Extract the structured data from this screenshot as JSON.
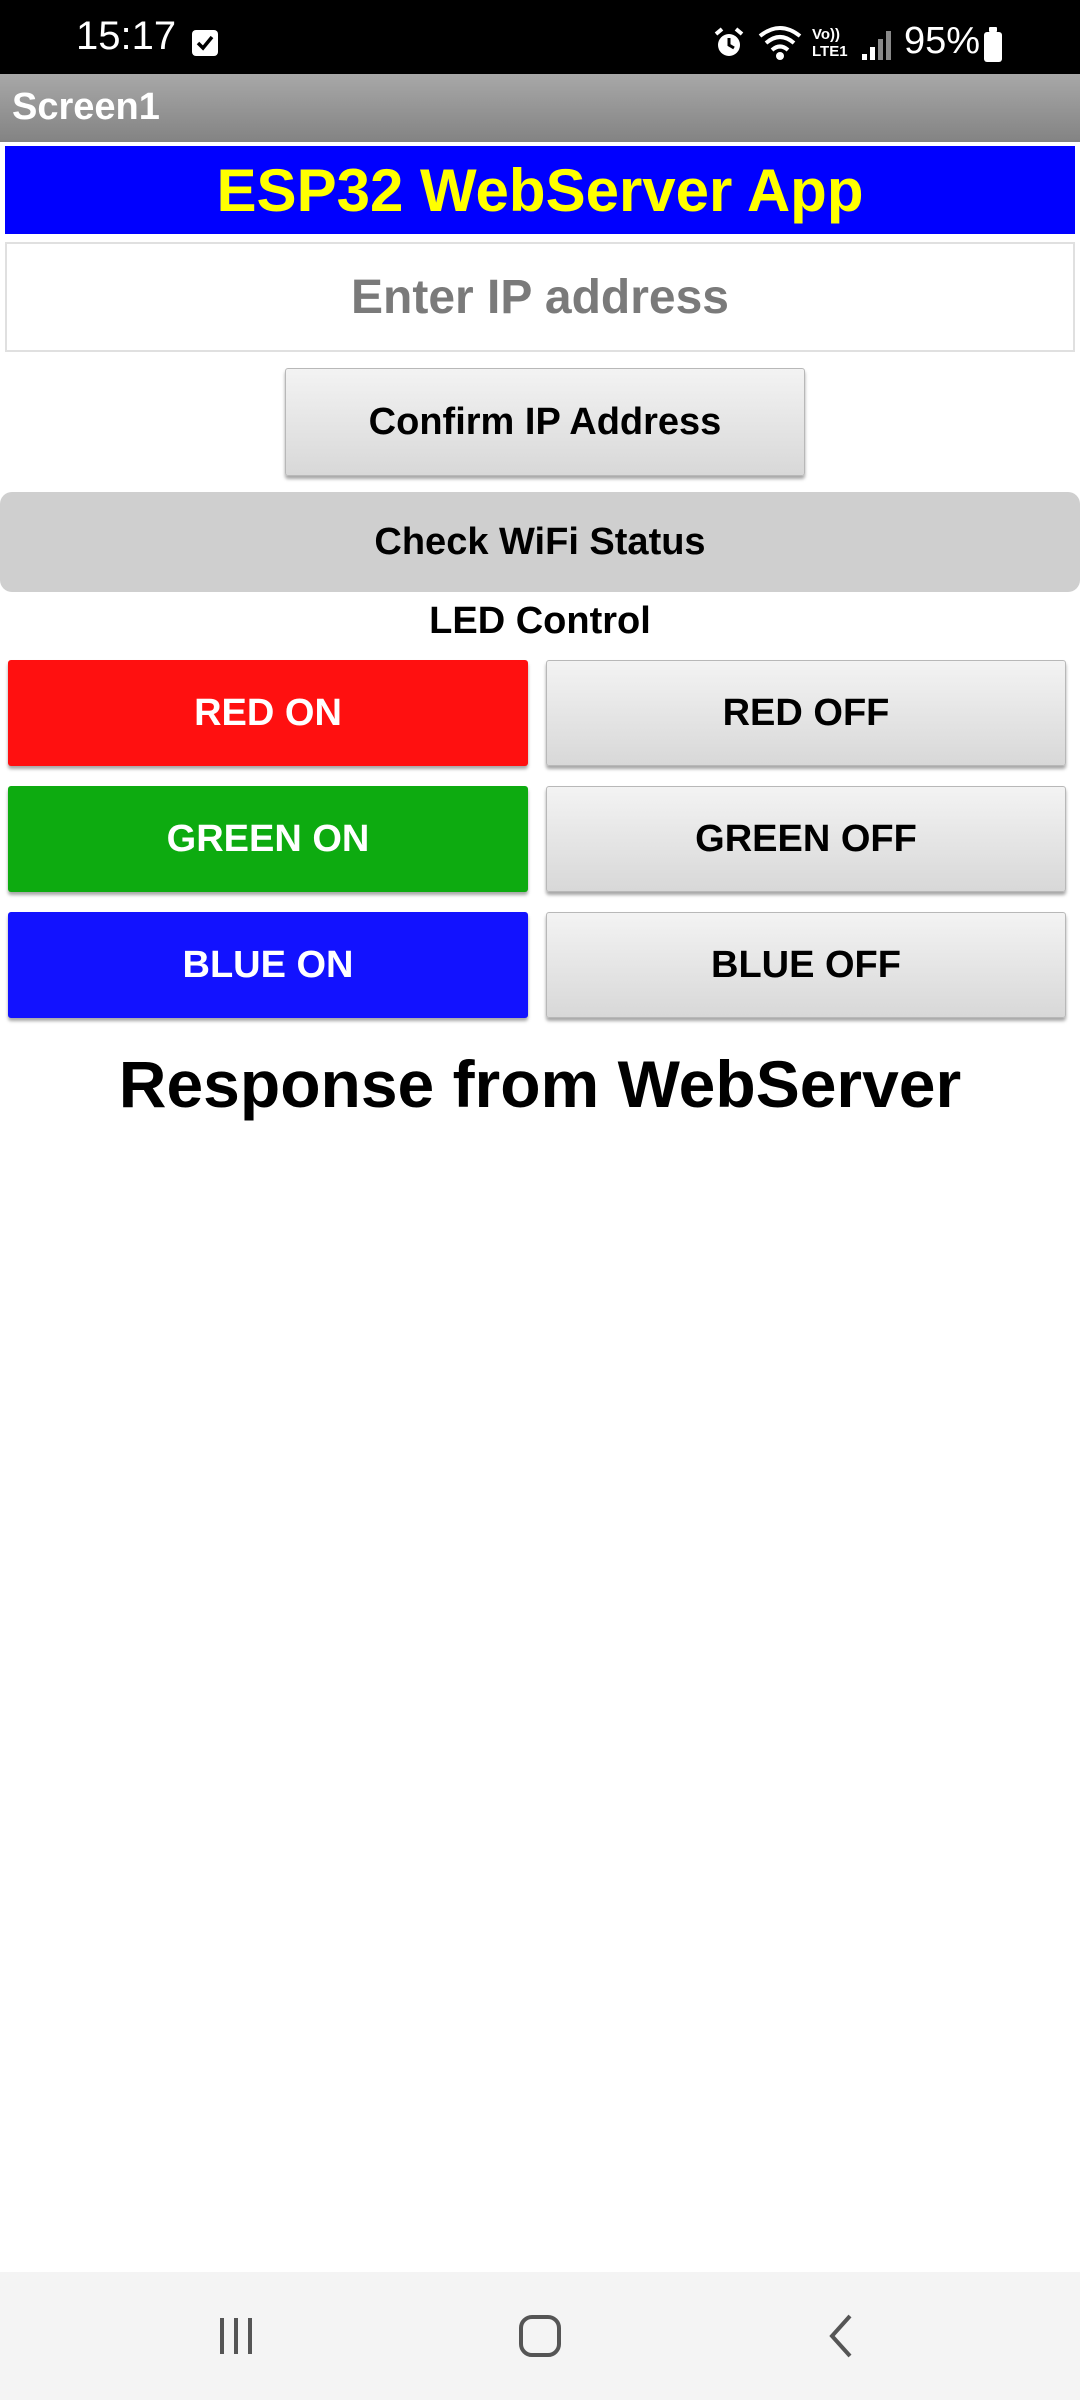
{
  "status_bar": {
    "time": "15:17",
    "battery": "95%",
    "network_label": "Vo)) LTE1"
  },
  "screen_title": "Screen1",
  "app_header": "ESP32 WebServer App",
  "ip_input": {
    "placeholder": "Enter IP address",
    "value": ""
  },
  "buttons": {
    "confirm_ip": "Confirm IP Address",
    "check_wifi": "Check WiFi Status"
  },
  "led_control": {
    "label": "LED Control",
    "rows": [
      {
        "on": "RED ON",
        "off": "RED OFF",
        "on_color": "#ff1010"
      },
      {
        "on": "GREEN ON",
        "off": "GREEN OFF",
        "on_color": "#0dab10"
      },
      {
        "on": "BLUE ON",
        "off": "BLUE OFF",
        "on_color": "#1212ff"
      }
    ]
  },
  "response_label": "Response from WebServer",
  "icons": {
    "status": [
      "checkbox-notification-icon",
      "alarm-icon",
      "wifi-icon",
      "volte-icon",
      "signal-icon",
      "battery-icon"
    ],
    "nav": [
      "recent-apps-icon",
      "home-icon",
      "back-icon"
    ]
  }
}
